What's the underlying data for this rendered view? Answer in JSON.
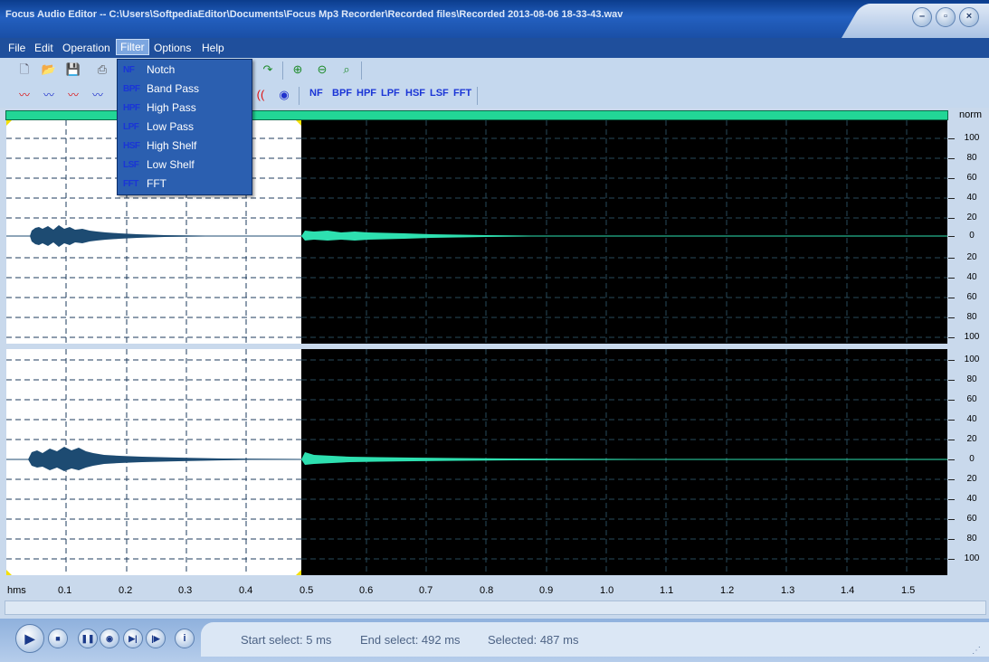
{
  "window": {
    "title": "Focus Audio Editor -- C:\\Users\\SoftpediaEditor\\Documents\\Focus Mp3 Recorder\\Recorded files\\Recorded 2013-08-06 18-33-43.wav",
    "controls": [
      "minimize-icon",
      "restore-icon",
      "close-icon"
    ]
  },
  "menu": [
    "File",
    "Edit",
    "Operation",
    "Filter",
    "Options",
    "Help"
  ],
  "toolbar2_filters": [
    "NF",
    "BPF",
    "HPF",
    "LPF",
    "HSF",
    "LSF",
    "FFT"
  ],
  "filter_menu": [
    {
      "abbr": "NF",
      "label": "Notch"
    },
    {
      "abbr": "BPF",
      "label": "Band Pass"
    },
    {
      "abbr": "HPF",
      "label": "High Pass"
    },
    {
      "abbr": "LPF",
      "label": "Low Pass"
    },
    {
      "abbr": "HSF",
      "label": "High Shelf"
    },
    {
      "abbr": "LSF",
      "label": "Low Shelf"
    },
    {
      "abbr": "FFT",
      "label": "FFT"
    }
  ],
  "scale": {
    "unit": "norm",
    "ticks": [
      "100",
      "80",
      "60",
      "40",
      "20",
      "0",
      "20",
      "40",
      "60",
      "80",
      "100"
    ]
  },
  "timeline": {
    "unit": "hms",
    "ticks": [
      "0.1",
      "0.2",
      "0.3",
      "0.4",
      "0.5",
      "0.6",
      "0.7",
      "0.8",
      "0.9",
      "1.0",
      "1.1",
      "1.2",
      "1.3",
      "1.4",
      "1.5"
    ]
  },
  "status": {
    "start_select": "Start select: 5 ms",
    "end_select": "End select: 492 ms",
    "selected": "Selected: 487 ms"
  },
  "colors": {
    "waveform_active": "#2ee0b0",
    "waveform_selected": "#1d4b72",
    "menu_bar": "#1f4f9c",
    "progress_bar": "#22d696"
  }
}
